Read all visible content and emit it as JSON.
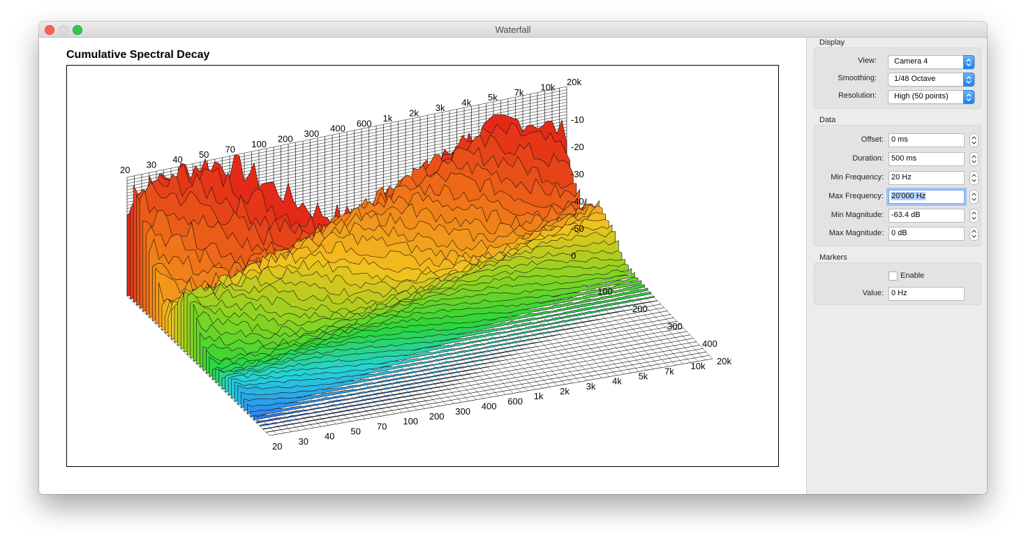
{
  "window": {
    "title": "Waterfall"
  },
  "chart": {
    "title": "Cumulative Spectral Decay"
  },
  "chart_data": {
    "type": "waterfall",
    "title": "Cumulative Spectral Decay",
    "back_freq_ticks": [
      "20",
      "30",
      "40",
      "50",
      "70",
      "100",
      "200",
      "300",
      "400",
      "600",
      "1k",
      "2k",
      "3k",
      "4k",
      "5k",
      "7k",
      "10k",
      "20k"
    ],
    "front_freq_ticks": [
      "20",
      "30",
      "40",
      "50",
      "70",
      "100",
      "200",
      "300",
      "400",
      "600",
      "1k",
      "2k",
      "3k",
      "4k",
      "5k",
      "7k",
      "10k",
      "20k"
    ],
    "magnitude_ticks": [
      "-10",
      "-20",
      "-30",
      "-40",
      "-50",
      "0"
    ],
    "time_ticks": [
      "100",
      "200",
      "300",
      "400"
    ],
    "colormap": [
      "#e32a18",
      "#f07a18",
      "#f2c21f",
      "#8ed320",
      "#2bd63a",
      "#27d3d6",
      "#2e8ff0",
      "#2a3ee8"
    ]
  },
  "sidebar": {
    "display": {
      "title": "Display",
      "view_label": "View:",
      "view_value": "Camera 4",
      "smoothing_label": "Smoothing:",
      "smoothing_value": "1/48 Octave",
      "resolution_label": "Resolution:",
      "resolution_value": "High (50 points)"
    },
    "data": {
      "title": "Data",
      "offset_label": "Offset:",
      "offset_value": "0 ms",
      "duration_label": "Duration:",
      "duration_value": "500 ms",
      "minfreq_label": "Min Frequency:",
      "minfreq_value": "20 Hz",
      "maxfreq_label": "Max Frequency:",
      "maxfreq_value": "20'000 Hz",
      "minmag_label": "Min Magnitude:",
      "minmag_value": "-63.4 dB",
      "maxmag_label": "Max Magnitude:",
      "maxmag_value": "0 dB"
    },
    "markers": {
      "title": "Markers",
      "enable_label": "Enable",
      "value_label": "Value:",
      "value_value": "0 Hz"
    }
  }
}
